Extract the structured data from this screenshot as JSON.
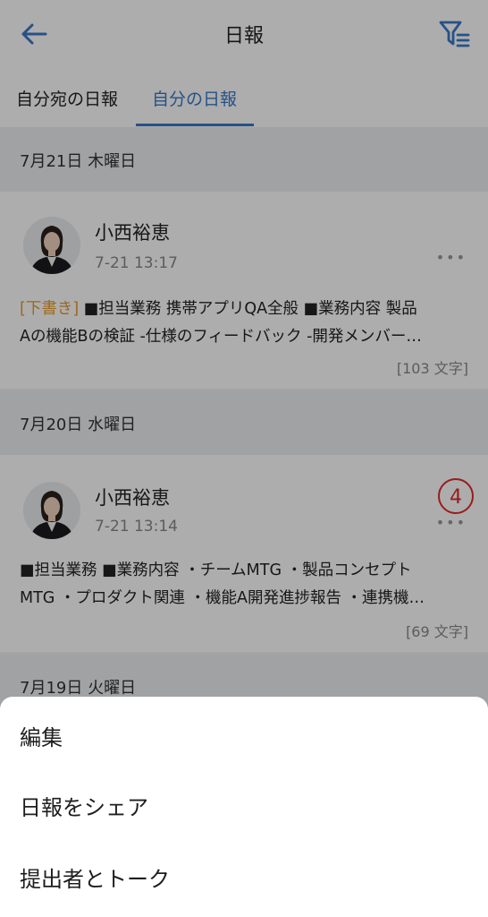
{
  "header": {
    "title": "日報"
  },
  "tabs": [
    {
      "label": "自分宛の日報",
      "active": false
    },
    {
      "label": "自分の日報",
      "active": true
    }
  ],
  "sections": [
    {
      "date": "7月21日 木曜日",
      "report": {
        "name": "小西裕恵",
        "time": "7-21 13:17",
        "draft_label": "[下書き]",
        "line1": " ■担当業務 携帯アプリQA全般 ■業務内容 製品",
        "line2": "Aの機能Bの検証 -仕様のフィードバック -開発メンバー…",
        "count": "[103 文字]"
      }
    },
    {
      "date": "7月20日 水曜日",
      "report": {
        "name": "小西裕恵",
        "time": "7-21 13:14",
        "line1": "■担当業務 ■業務内容 ・チームMTG ・製品コンセプト",
        "line2": "MTG ・プロダクト関連 ・機能A開発進捗報告 ・連携機…",
        "count": "[69 文字]"
      }
    },
    {
      "date": "7月19日 火曜日"
    }
  ],
  "annotation": {
    "step_number": "4"
  },
  "action_sheet": {
    "items": [
      "編集",
      "日報をシェア",
      "提出者とトーク"
    ]
  },
  "colors": {
    "accent": "#3a78c9",
    "draft": "#e69a2a",
    "annotation": "#e02a2a"
  },
  "icons": {
    "back": "arrow-left-icon",
    "filter": "filter-icon",
    "more": "more-dots-icon"
  }
}
